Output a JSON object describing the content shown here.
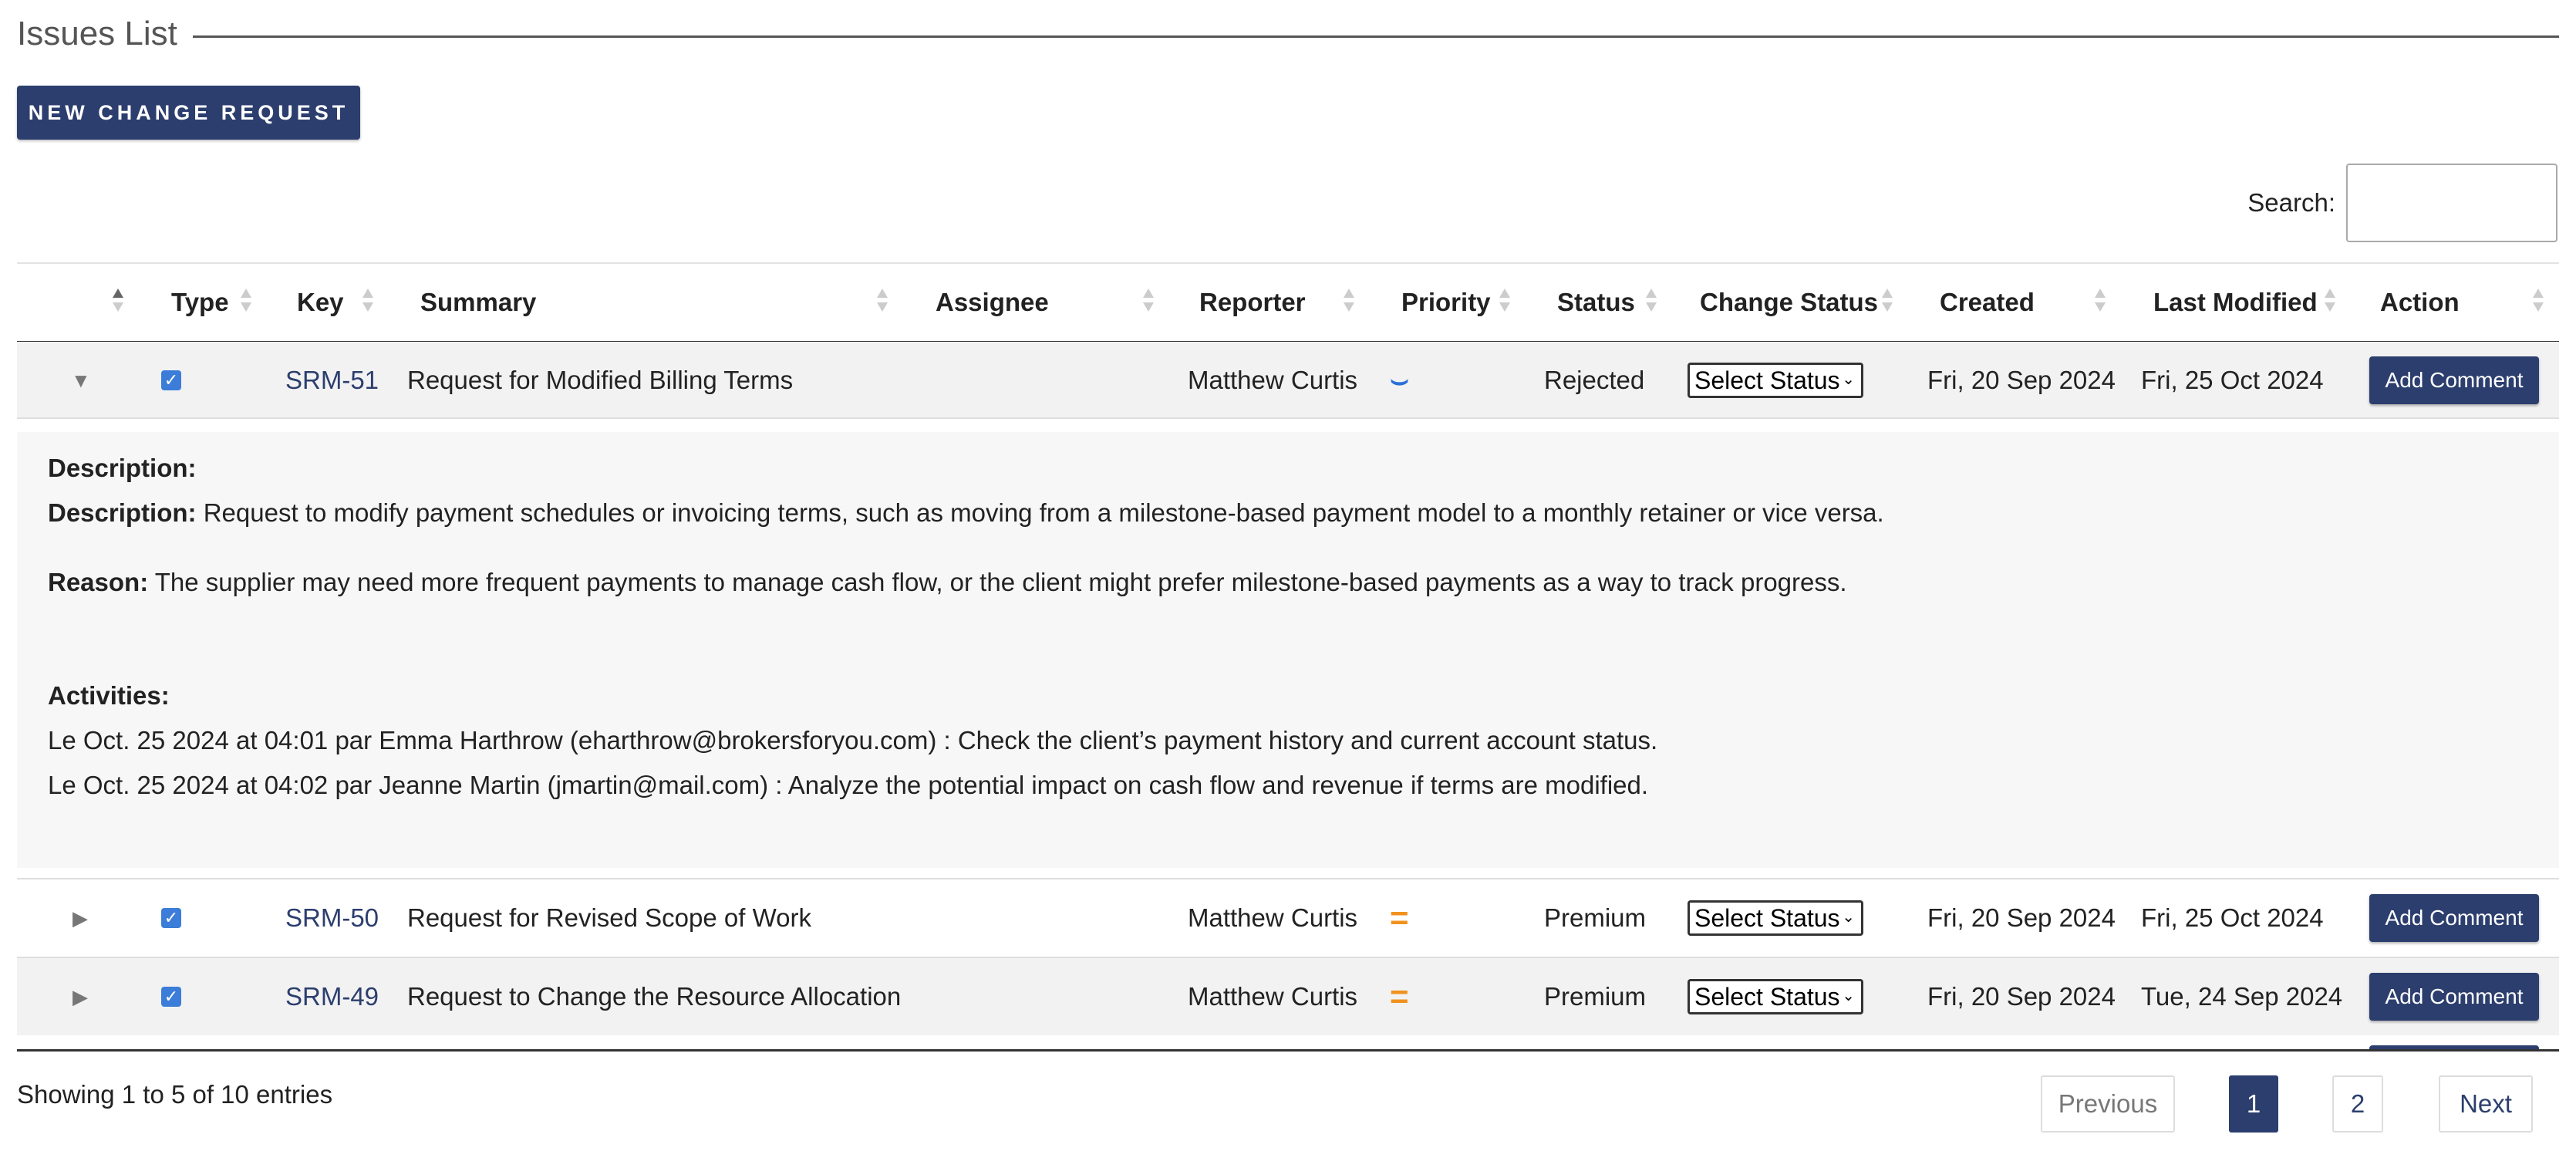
{
  "page": {
    "title": "Issues List"
  },
  "toolbar": {
    "new_request_label": "NEW CHANGE REQUEST"
  },
  "search": {
    "label": "Search:",
    "value": ""
  },
  "table": {
    "columns": [
      {
        "key": "toggle",
        "label": ""
      },
      {
        "key": "type",
        "label": "Type"
      },
      {
        "key": "key",
        "label": "Key"
      },
      {
        "key": "summary",
        "label": "Summary"
      },
      {
        "key": "assignee",
        "label": "Assignee"
      },
      {
        "key": "reporter",
        "label": "Reporter"
      },
      {
        "key": "priority",
        "label": "Priority"
      },
      {
        "key": "status",
        "label": "Status"
      },
      {
        "key": "change_status",
        "label": "Change Status"
      },
      {
        "key": "created",
        "label": "Created"
      },
      {
        "key": "last_modified",
        "label": "Last Modified"
      },
      {
        "key": "action",
        "label": "Action"
      }
    ],
    "rows": [
      {
        "expanded": true,
        "toggle_icon": "triangle-down-icon",
        "type_checked": true,
        "key": "SRM-51",
        "summary": "Request for Modified Billing Terms",
        "assignee": "",
        "reporter": "Matthew Curtis",
        "priority_icon": "priority-low-icon",
        "priority_glyph": "⌣",
        "status": "Rejected",
        "change_status": "Select Status",
        "created": "Fri, 20 Sep 2024",
        "last_modified": "Fri, 25 Oct 2024",
        "action": "Add Comment"
      },
      {
        "expanded": false,
        "toggle_icon": "triangle-right-icon",
        "type_checked": true,
        "key": "SRM-50",
        "summary": "Request for Revised Scope of Work",
        "assignee": "",
        "reporter": "Matthew Curtis",
        "priority_icon": "priority-medium-icon",
        "priority_glyph": "=",
        "status": "Premium",
        "change_status": "Select Status",
        "created": "Fri, 20 Sep 2024",
        "last_modified": "Fri, 25 Oct 2024",
        "action": "Add Comment"
      },
      {
        "expanded": false,
        "toggle_icon": "triangle-right-icon",
        "type_checked": true,
        "key": "SRM-49",
        "summary": "Request to Change the Resource Allocation",
        "assignee": "",
        "reporter": "Matthew Curtis",
        "priority_icon": "priority-medium-icon",
        "priority_glyph": "=",
        "status": "Premium",
        "change_status": "Select Status",
        "created": "Fri, 20 Sep 2024",
        "last_modified": "Tue, 24 Sep 2024",
        "action": "Add Comment"
      }
    ]
  },
  "detail": {
    "description_heading": "Description:",
    "description_label": "Description:",
    "description_text": " Request to modify payment schedules or invoicing terms, such as moving from a milestone-based payment model to a monthly retainer or vice versa.",
    "reason_label": "Reason:",
    "reason_text": " The supplier may need more frequent payments to manage cash flow, or the client might prefer milestone-based payments as a way to track progress.",
    "activities_heading": "Activities:",
    "activities": [
      "Le Oct. 25 2024 at 04:01 par Emma Harthrow (eharthrow@brokersforyou.com) : Check the client’s payment history and current account status.",
      "Le Oct. 25 2024 at 04:02 par Jeanne Martin (jmartin@mail.com) : Analyze the potential impact on cash flow and revenue if terms are modified."
    ]
  },
  "footer": {
    "info": "Showing 1 to 5 of 10 entries",
    "previous": "Previous",
    "pages": [
      "1",
      "2"
    ],
    "next": "Next"
  },
  "colors": {
    "brand": "#2c3e6e",
    "checkbox": "#3b7dd8",
    "priority_low": "#2b6fd6",
    "priority_medium": "#f0921e"
  }
}
